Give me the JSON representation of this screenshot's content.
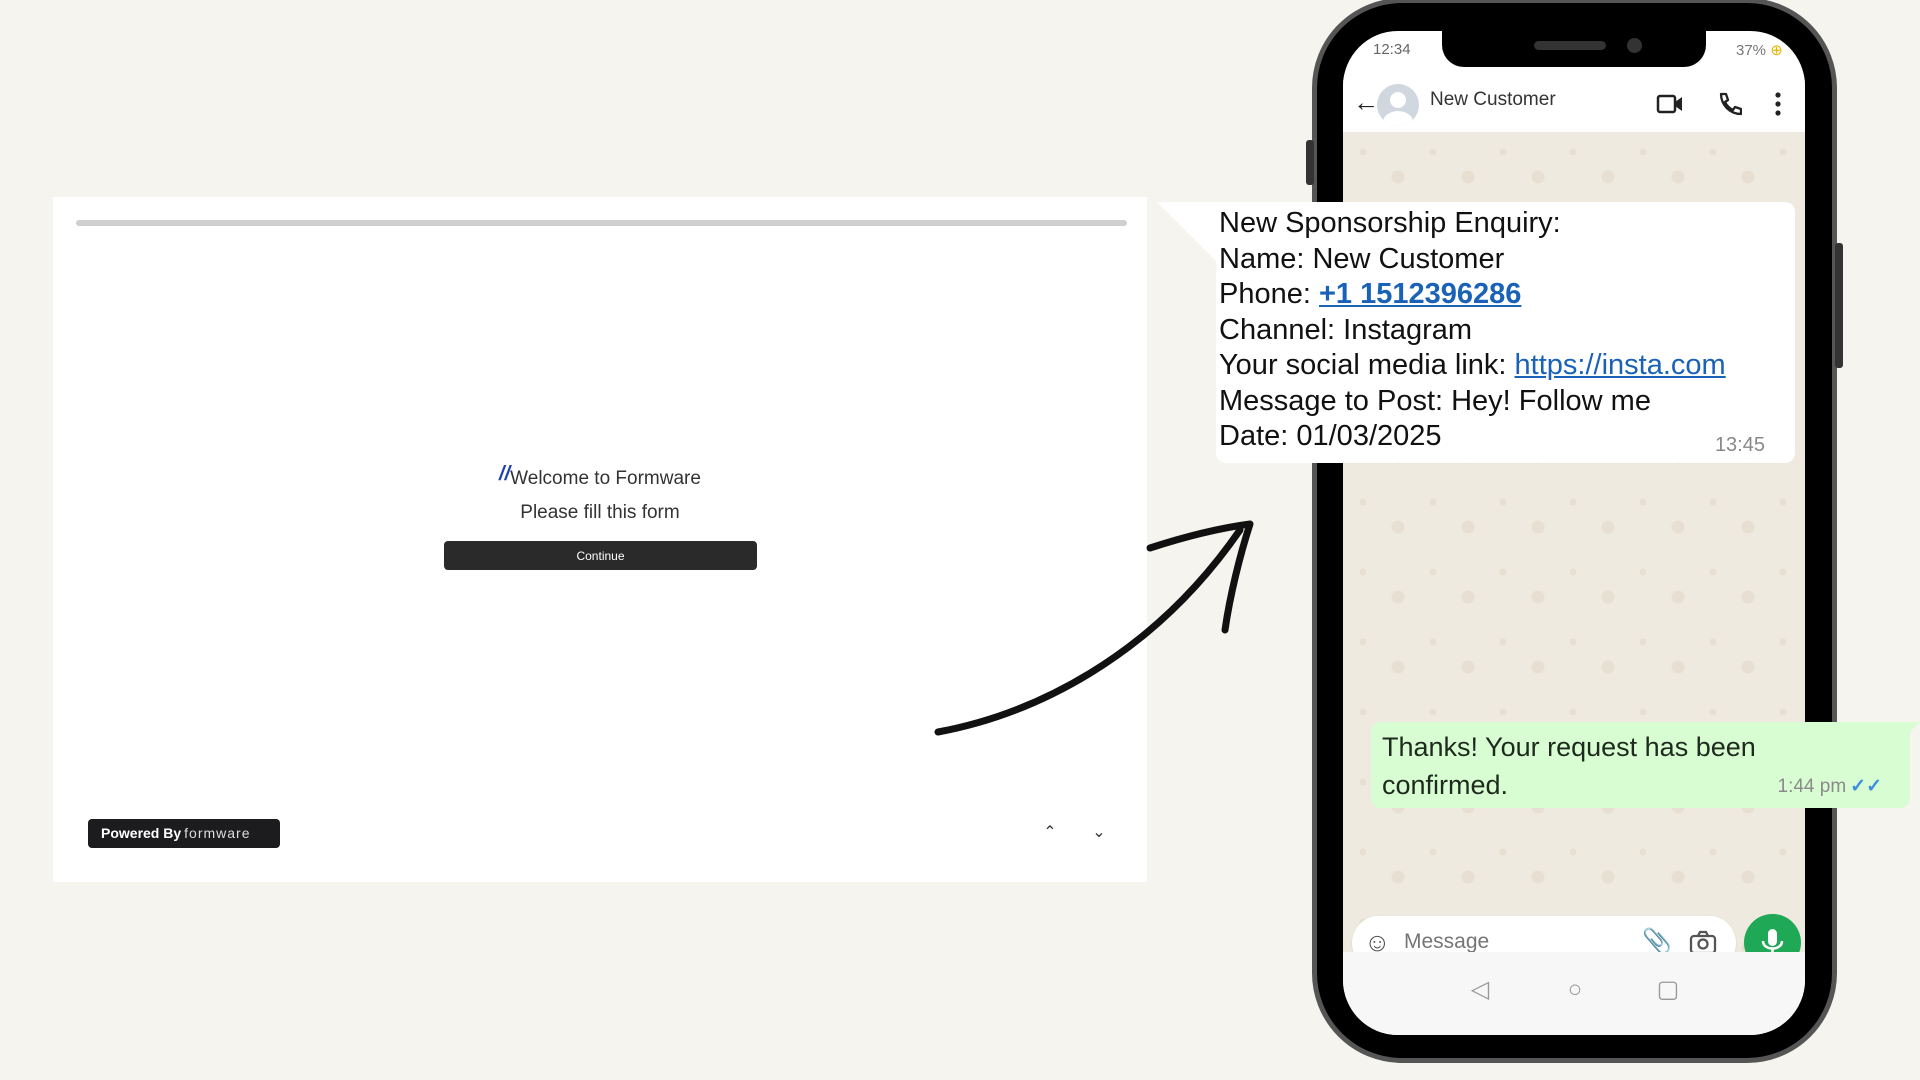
{
  "form": {
    "quote_mark": "”",
    "welcome": "Welcome to Formware",
    "subtitle": "Please fill this form",
    "continue_label": "Continue",
    "powered_by": "Powered By",
    "brand": "formware",
    "progress_percent": 0
  },
  "phone": {
    "status_time": "12:34",
    "battery": "37%",
    "contact_name": "New Customer",
    "incoming": {
      "lines": [
        "New Sponsorship Enquiry:",
        "Name: New Customer"
      ],
      "phone_label": "Phone: ",
      "phone_value": "+1 1512396286",
      "channel": "Channel: Instagram",
      "social_label": "Your social media link: ",
      "social_value": "https://insta.com",
      "message": "Message to Post: Hey! Follow me",
      "date": "Date: 01/03/2025",
      "time": "13:45"
    },
    "outgoing": {
      "text": "Thanks! Your request has been confirmed.",
      "time": "1:44 pm",
      "ticks": "✓✓"
    },
    "message_placeholder": "Message"
  },
  "colors": {
    "background": "#f6f4ee",
    "outgoing_bubble": "#d9fdd3",
    "mic_button": "#1fa855",
    "link": "#1a62b8"
  }
}
